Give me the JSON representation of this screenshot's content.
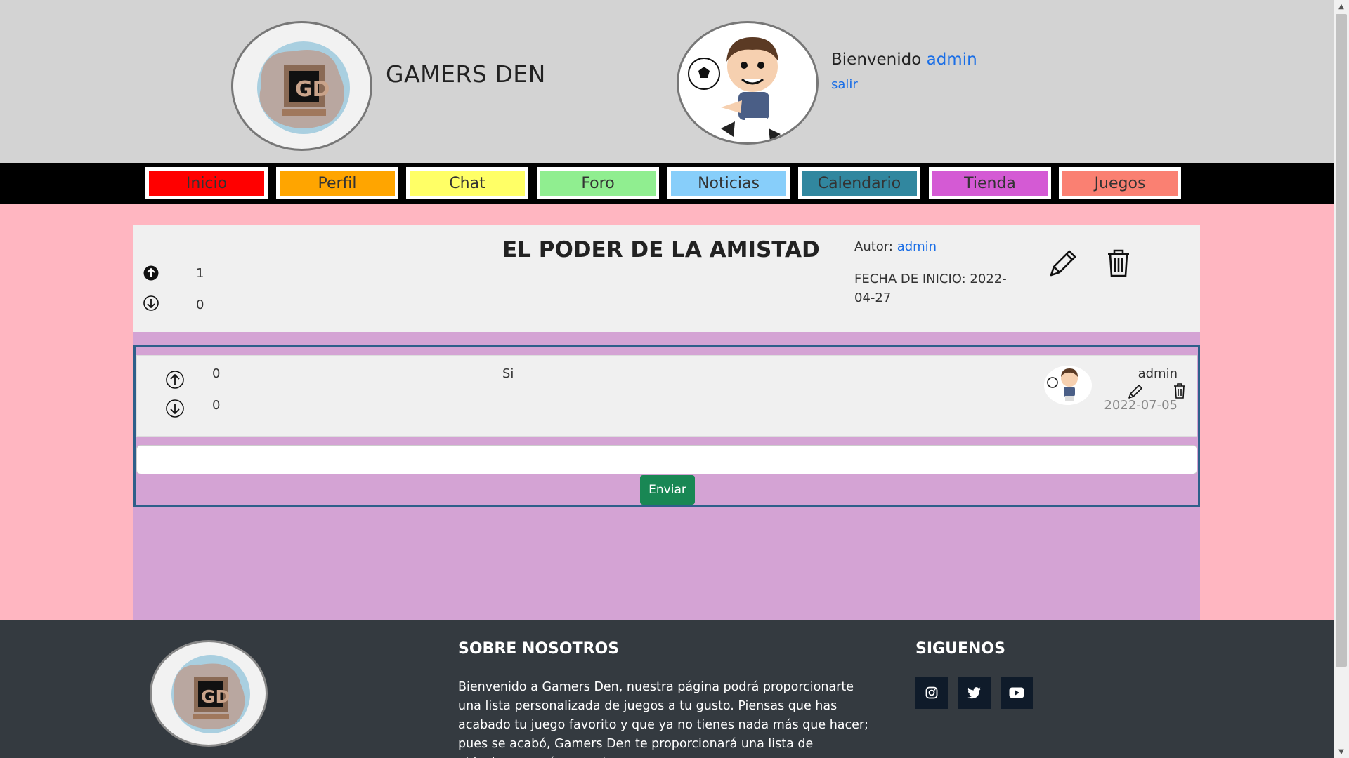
{
  "header": {
    "site_title": "GAMERS DEN",
    "welcome_prefix": "Bienvenido",
    "user_name": "admin",
    "logout_label": "salir"
  },
  "nav": {
    "items": [
      {
        "label": "Inicio",
        "color": "#ff0000"
      },
      {
        "label": "Perfil",
        "color": "#ffa500"
      },
      {
        "label": "Chat",
        "color": "#ffff66"
      },
      {
        "label": "Foro",
        "color": "#90ee90"
      },
      {
        "label": "Noticias",
        "color": "#87cefa"
      },
      {
        "label": "Calendario",
        "color": "#31879f"
      },
      {
        "label": "Tienda",
        "color": "#d45ad4"
      },
      {
        "label": "Juegos",
        "color": "#fa8072"
      }
    ]
  },
  "thread": {
    "title": "EL PODER DE LA AMISTAD",
    "upvotes": "1",
    "downvotes": "0",
    "author_prefix": "Autor:",
    "author": "admin",
    "start_date": "FECHA DE INICIO: 2022-04-27"
  },
  "comments": [
    {
      "upvotes": "0",
      "downvotes": "0",
      "text": "Si",
      "author": "admin",
      "date": "2022-07-05"
    }
  ],
  "comment_form": {
    "input_value": "",
    "send_label": "Enviar"
  },
  "footer": {
    "about_heading": "SOBRE NOSOTROS",
    "about_text": "Bienvenido a Gamers Den, nuestra página podrá proporcionarte una lista personalizada de juegos a tu gusto. Piensas que has acabado tu juego favorito y que ya no tienes nada más que hacer; pues se acabó, Gamers Den te proporcionará una lista de videojuegos así como otras",
    "follow_heading": "SIGUENOS",
    "social": [
      "instagram-icon",
      "twitter-icon",
      "youtube-icon"
    ]
  },
  "colors": {
    "page_bg": "#ffb6c1",
    "header_bg": "#d3d3d3",
    "content_bg": "#d4a3d4",
    "footer_bg": "#343a40",
    "send_button": "#198754",
    "link": "#1a6ee6"
  }
}
